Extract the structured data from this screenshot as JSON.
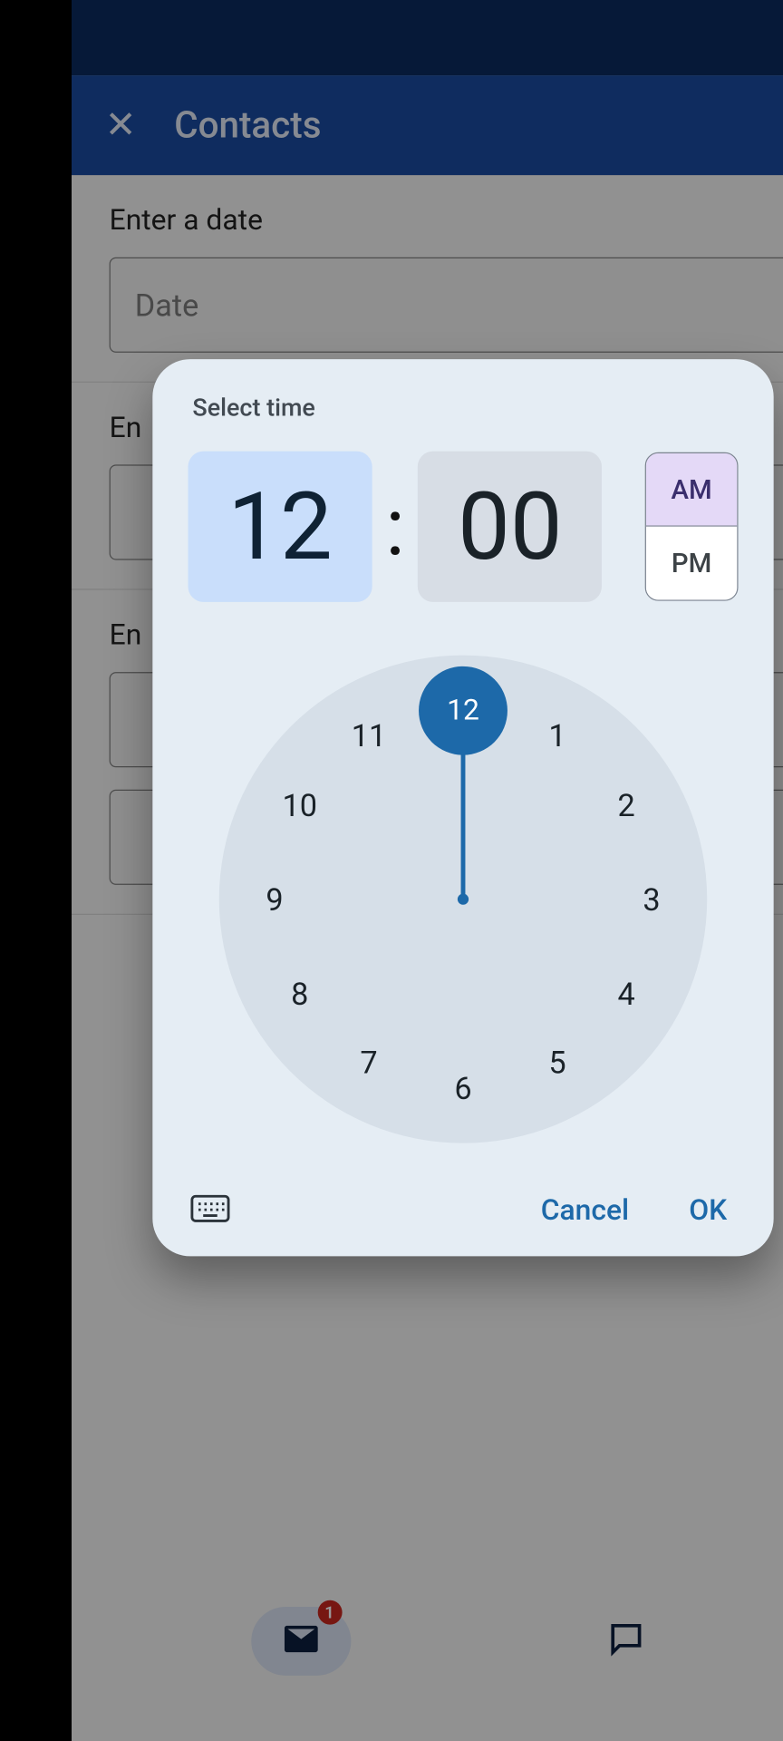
{
  "statusbar": {},
  "appbar": {
    "title": "Contacts"
  },
  "form": {
    "date": {
      "label": "Enter a date",
      "placeholder": "Date"
    },
    "row2": {
      "label": "En"
    },
    "row3": {
      "label": "En"
    }
  },
  "bottomnav": {
    "mail_badge": "1"
  },
  "dialog": {
    "title": "Select time",
    "hour": "12",
    "minute": "00",
    "colon": ":",
    "am_label": "AM",
    "pm_label": "PM",
    "period_selected": "AM",
    "clock_hours": [
      "12",
      "1",
      "2",
      "3",
      "4",
      "5",
      "6",
      "7",
      "8",
      "9",
      "10",
      "11"
    ],
    "selected_hour": "12",
    "cancel": "Cancel",
    "ok": "OK"
  }
}
